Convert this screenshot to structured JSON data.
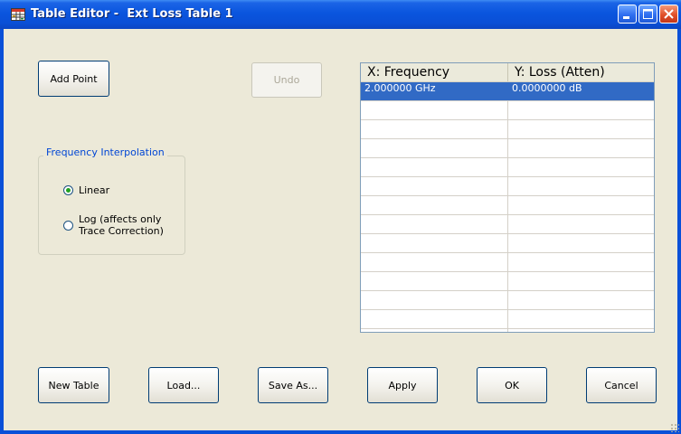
{
  "window": {
    "title": "Table Editor -  Ext Loss Table 1",
    "icon": "table-app-icon",
    "controls": [
      "minimize-icon",
      "maximize-icon",
      "close-icon"
    ]
  },
  "toolbar": {
    "add_point_label": "Add Point",
    "undo_label": "Undo",
    "undo_enabled": false
  },
  "interpolation": {
    "group_title": "Frequency Interpolation",
    "options": [
      {
        "label_lines": [
          "Linear"
        ],
        "selected": true
      },
      {
        "label_lines": [
          "Log (affects only",
          "Trace Correction)"
        ],
        "selected": false
      }
    ]
  },
  "table": {
    "columns": [
      "X: Frequency",
      "Y: Loss (Atten)"
    ],
    "rows": [
      {
        "frequency": "2.000000 GHz",
        "loss": "0.0000000 dB",
        "selected": true
      }
    ],
    "empty_rows": 12
  },
  "footer": {
    "new_table_label": "New Table",
    "load_label": "Load...",
    "save_as_label": "Save As...",
    "apply_label": "Apply",
    "ok_label": "OK",
    "cancel_label": "Cancel"
  },
  "colors": {
    "titlebar": "#0a55de",
    "client_bg": "#ece9d8",
    "selection": "#316ac5",
    "group_title": "#0046d5",
    "radio_dot": "#21a121"
  }
}
